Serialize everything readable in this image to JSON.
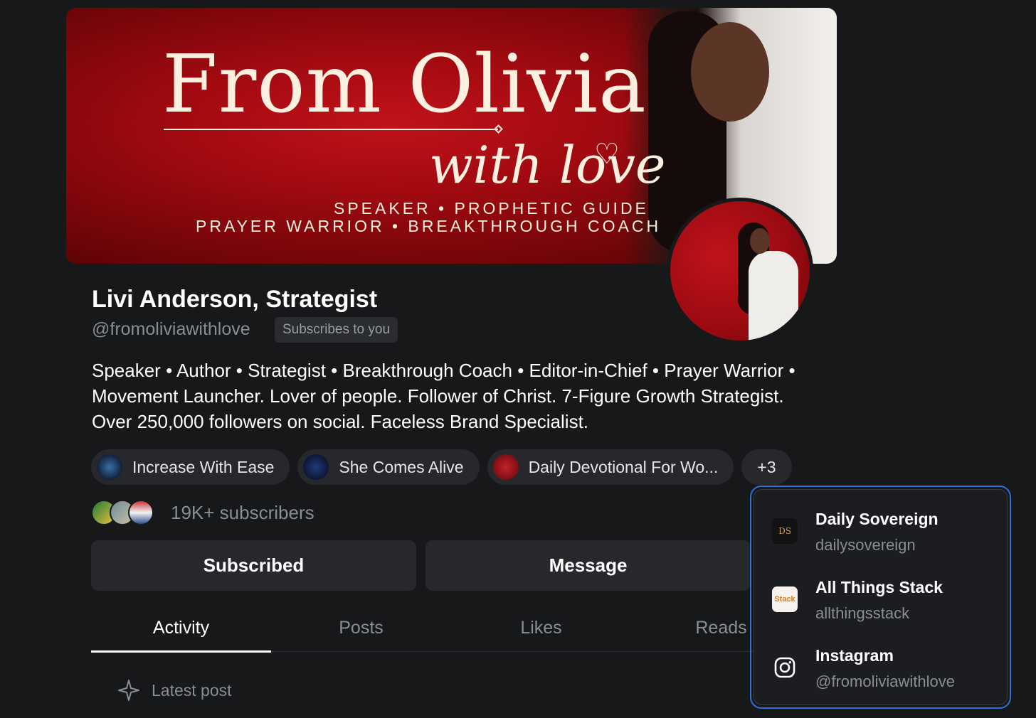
{
  "banner": {
    "title": "From Olivia",
    "script": "with love",
    "tagline_1": "SPEAKER • PROPHETIC GUIDE",
    "tagline_2": "PRAYER WARRIOR • BREAKTHROUGH COACH"
  },
  "profile": {
    "name": "Livi Anderson, Strategist",
    "handle": "@fromoliviawithlove",
    "subscribes_badge": "Subscribes to you",
    "bio": "Speaker • Author • Strategist • Breakthrough Coach • Editor-in-Chief • Prayer Warrior • Movement Launcher. Lover of people. Follower of Christ. 7-Figure Growth Strategist. Over 250,000 followers on social. Faceless Brand Specialist."
  },
  "publications": [
    {
      "label": "Increase With Ease"
    },
    {
      "label": "She Comes Alive"
    },
    {
      "label": "Daily Devotional For Wo..."
    },
    {
      "label": "+3"
    }
  ],
  "subscribers": {
    "count_label": "19K+ subscribers"
  },
  "actions": {
    "subscribed_label": "Subscribed",
    "message_label": "Message"
  },
  "tabs": [
    {
      "label": "Activity",
      "active": true
    },
    {
      "label": "Posts",
      "active": false
    },
    {
      "label": "Likes",
      "active": false
    },
    {
      "label": "Reads",
      "active": false
    }
  ],
  "feed": {
    "latest_label": "Latest post"
  },
  "dropdown": {
    "items": [
      {
        "title": "Daily Sovereign",
        "subtitle": "dailysovereign",
        "icon": "DS"
      },
      {
        "title": "All Things Stack",
        "subtitle": "allthingsstack",
        "icon": "Stack"
      },
      {
        "title": "Instagram",
        "subtitle": "@fromoliviawithlove",
        "icon": "instagram-icon"
      }
    ]
  },
  "colors": {
    "background": "#17181a",
    "surface": "#26282b",
    "accent_focus": "#2f6fd6",
    "banner_red": "#a00a10",
    "banner_text": "#fbf0df"
  }
}
